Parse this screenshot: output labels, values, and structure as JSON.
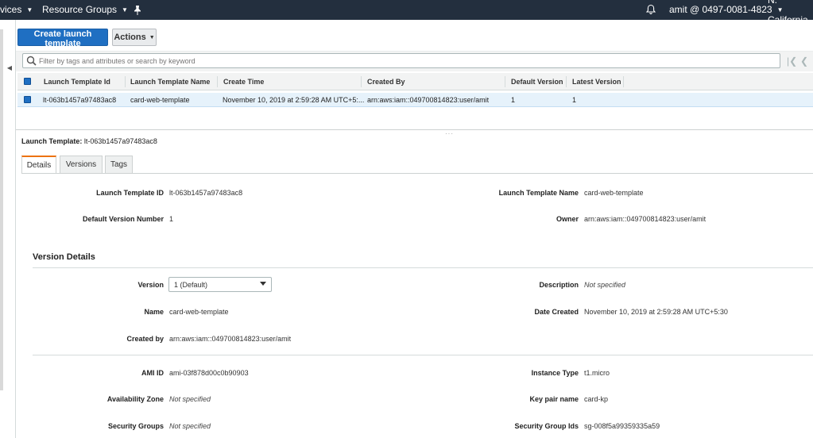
{
  "topnav": {
    "services": "vices",
    "resource_groups": "Resource Groups",
    "account": "amit @ 0497-0081-4823",
    "region": "N. California",
    "icons": {
      "pin": "pin-icon",
      "bell": "bell-icon",
      "caret": "chevron-down-icon"
    }
  },
  "toolbar": {
    "create_label": "Create launch template",
    "actions_label": "Actions"
  },
  "filter": {
    "placeholder": "Filter by tags and attributes or search by keyword"
  },
  "table": {
    "columns": [
      "Launch Template Id",
      "Launch Template Name",
      "Create Time",
      "Created By",
      "Default Version",
      "Latest Version"
    ],
    "rows": [
      {
        "id": "lt-063b1457a97483ac8",
        "name": "card-web-template",
        "create_time": "November 10, 2019 at 2:59:28 AM UTC+5:...",
        "created_by": "arn:aws:iam::049700814823:user/amit",
        "default_version": "1",
        "latest_version": "1"
      }
    ]
  },
  "detail": {
    "header_label": "Launch Template:",
    "header_value": "lt-063b1457a97483ac8",
    "tabs": [
      "Details",
      "Versions",
      "Tags"
    ],
    "fields": {
      "template_id_label": "Launch Template ID",
      "template_id_value": "lt-063b1457a97483ac8",
      "template_name_label": "Launch Template Name",
      "template_name_value": "card-web-template",
      "default_version_label": "Default Version Number",
      "default_version_value": "1",
      "owner_label": "Owner",
      "owner_value": "arn:aws:iam::049700814823:user/amit"
    },
    "version_details": {
      "title": "Version Details",
      "version_label": "Version",
      "version_value": "1 (Default)",
      "description_label": "Description",
      "description_value": "Not specified",
      "name_label": "Name",
      "name_value": "card-web-template",
      "date_created_label": "Date Created",
      "date_created_value": "November 10, 2019 at 2:59:28 AM UTC+5:30",
      "created_by_label": "Created by",
      "created_by_value": "arn:aws:iam::049700814823:user/amit",
      "ami_label": "AMI ID",
      "ami_value": "ami-03f878d00c0b90903",
      "instance_type_label": "Instance Type",
      "instance_type_value": "t1.micro",
      "az_label": "Availability Zone",
      "az_value": "Not specified",
      "key_pair_label": "Key pair name",
      "key_pair_value": "card-kp",
      "sg_label": "Security Groups",
      "sg_value": "Not specified",
      "sg_ids_label": "Security Group Ids",
      "sg_ids_value": "sg-008f5a99359335a59"
    }
  },
  "colors": {
    "nav_bg": "#232f3e",
    "primary": "#1f6fc2",
    "tab_accent": "#ec7211",
    "selected_row": "#e6f2fb"
  }
}
